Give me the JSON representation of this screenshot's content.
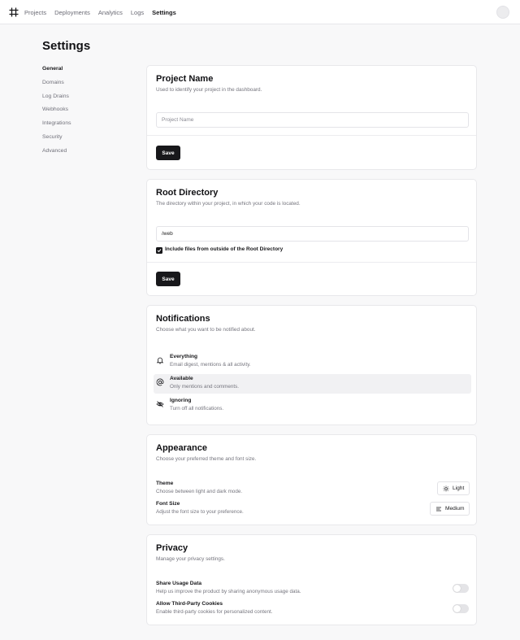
{
  "nav": {
    "links": [
      "Projects",
      "Deployments",
      "Analytics",
      "Logs",
      "Settings"
    ],
    "active": "Settings"
  },
  "page": {
    "title": "Settings"
  },
  "sidebar": {
    "items": [
      "General",
      "Domains",
      "Log Drains",
      "Webhooks",
      "Integrations",
      "Security",
      "Advanced"
    ]
  },
  "project_name": {
    "title": "Project Name",
    "description": "Used to identify your project in the dashboard.",
    "placeholder": "Project Name",
    "save_label": "Save"
  },
  "root_directory": {
    "title": "Root Directory",
    "description": "The directory within your project, in which your code is located.",
    "value": "/web",
    "checkbox_label": "Include files from outside of the Root Directory",
    "checkbox_checked": true,
    "save_label": "Save"
  },
  "notifications": {
    "title": "Notifications",
    "description": "Choose what you want to be notified about.",
    "options": [
      {
        "title": "Everything",
        "subtitle": "Email digest, mentions & all activity.",
        "icon": "bell-icon"
      },
      {
        "title": "Available",
        "subtitle": "Only mentions and comments.",
        "icon": "at-sign-icon"
      },
      {
        "title": "Ignoring",
        "subtitle": "Turn off all notifications.",
        "icon": "eye-off-icon"
      }
    ],
    "selected": "Available"
  },
  "appearance": {
    "title": "Appearance",
    "description": "Choose your preferred theme and font size.",
    "theme_label": "Theme",
    "theme_desc": "Choose between light and dark mode.",
    "theme_value": "Light",
    "font_label": "Font Size",
    "font_desc": "Adjust the font size to your preference.",
    "font_value": "Medium"
  },
  "privacy": {
    "title": "Privacy",
    "description": "Manage your privacy settings.",
    "usage_label": "Share Usage Data",
    "usage_desc": "Help us improve the product by sharing anonymous usage data.",
    "usage_enabled": false,
    "cookies_label": "Allow Third-Party Cookies",
    "cookies_desc": "Enable third-party cookies for personalized content.",
    "cookies_enabled": false
  }
}
